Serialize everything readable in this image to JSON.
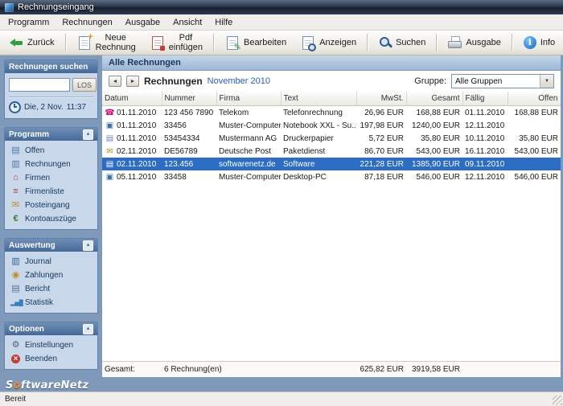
{
  "window": {
    "title": "Rechnungseingang",
    "status": "Bereit"
  },
  "menubar": {
    "items": [
      {
        "label": "Programm"
      },
      {
        "label": "Rechnungen"
      },
      {
        "label": "Ausgabe"
      },
      {
        "label": "Ansicht"
      },
      {
        "label": "Hilfe"
      }
    ]
  },
  "toolbar": {
    "buttons": [
      {
        "label": "Zurück",
        "icon": "back-arrow"
      },
      {
        "label": "Neue Rechnung",
        "icon": "new-document"
      },
      {
        "label": "Pdf einfügen",
        "icon": "pdf-document"
      },
      {
        "label": "Bearbeiten",
        "icon": "edit-pencil"
      },
      {
        "label": "Anzeigen",
        "icon": "view-magnifier"
      },
      {
        "label": "Suchen",
        "icon": "search-magnifier"
      },
      {
        "label": "Ausgabe",
        "icon": "printer"
      },
      {
        "label": "Info",
        "icon": "info"
      }
    ]
  },
  "sidebar": {
    "search": {
      "title": "Rechnungen suchen",
      "input_value": "",
      "button_label": "LOS",
      "clock_icon": "clock",
      "date": "Die, 2 Nov.",
      "time": "11:37"
    },
    "sections": [
      {
        "title": "Programm",
        "items": [
          {
            "label": "Offen",
            "icon": "open-invoices"
          },
          {
            "label": "Rechnungen",
            "icon": "invoices"
          },
          {
            "label": "Firmen",
            "icon": "companies"
          },
          {
            "label": "Firmenliste",
            "icon": "company-list"
          },
          {
            "label": "Posteingang",
            "icon": "inbox"
          },
          {
            "label": "Kontoauszüge",
            "icon": "bank-statements"
          }
        ]
      },
      {
        "title": "Auswertung",
        "items": [
          {
            "label": "Journal",
            "icon": "journal"
          },
          {
            "label": "Zahlungen",
            "icon": "payments"
          },
          {
            "label": "Bericht",
            "icon": "report"
          },
          {
            "label": "Statistik",
            "icon": "statistics"
          }
        ]
      },
      {
        "title": "Optionen",
        "items": [
          {
            "label": "Einstellungen",
            "icon": "settings"
          },
          {
            "label": "Beenden",
            "icon": "quit"
          }
        ]
      }
    ],
    "logo": {
      "prefix": "S",
      "accent": "o",
      "suffix": "ftwareNetz"
    }
  },
  "main": {
    "panel_title": "Alle Rechnungen",
    "nav": {
      "prev": "◄",
      "next": "►",
      "title": "Rechnungen",
      "period": "November 2010"
    },
    "group": {
      "label": "Gruppe:",
      "selected": "Alle Gruppen"
    },
    "table": {
      "columns": {
        "datum": "Datum",
        "nummer": "Nummer",
        "firma": "Firma",
        "text": "Text",
        "mwst": "MwSt.",
        "gesamt": "Gesamt",
        "faellig": "Fällig",
        "offen": "Offen"
      },
      "selected_row_index": 4,
      "rows": [
        {
          "icon": "phone",
          "datum": "01.11.2010",
          "nummer": "123 456 7890",
          "firma": "Telekom",
          "text": "Telefonrechnung",
          "mwst": "26,96 EUR",
          "gesamt": "168,88 EUR",
          "faellig": "01.11.2010",
          "offen": "168,88 EUR"
        },
        {
          "icon": "computer",
          "datum": "01.11.2010",
          "nummer": "33456",
          "firma": "Muster-Computer",
          "text": "Notebook XXL - Su...",
          "mwst": "197,98 EUR",
          "gesamt": "1240,00 EUR",
          "faellig": "12.11.2010",
          "offen": ""
        },
        {
          "icon": "document",
          "datum": "01.11.2010",
          "nummer": "53454334",
          "firma": "Mustermann AG",
          "text": "Druckerpapier",
          "mwst": "5,72 EUR",
          "gesamt": "35,80 EUR",
          "faellig": "10.11.2010",
          "offen": "35,80 EUR"
        },
        {
          "icon": "mail",
          "datum": "02.11.2010",
          "nummer": "DE56789",
          "firma": "Deutsche Post",
          "text": "Paketdienst",
          "mwst": "86,70 EUR",
          "gesamt": "543,00 EUR",
          "faellig": "16.11.2010",
          "offen": "543,00 EUR"
        },
        {
          "icon": "document",
          "datum": "02.11.2010",
          "nummer": "123.456",
          "firma": "softwarenetz.de",
          "text": "Software",
          "mwst": "221,28 EUR",
          "gesamt": "1385,90 EUR",
          "faellig": "09.11.2010",
          "offen": ""
        },
        {
          "icon": "computer",
          "datum": "05.11.2010",
          "nummer": "33458",
          "firma": "Muster-Computer",
          "text": "Desktop-PC",
          "mwst": "87,18 EUR",
          "gesamt": "546,00 EUR",
          "faellig": "12.11.2010",
          "offen": "546,00 EUR"
        }
      ]
    },
    "summary": {
      "label": "Gesamt:",
      "count": "6 Rechnung(en)",
      "mwst_total": "625,82 EUR",
      "gesamt_total": "3919,58 EUR"
    }
  }
}
